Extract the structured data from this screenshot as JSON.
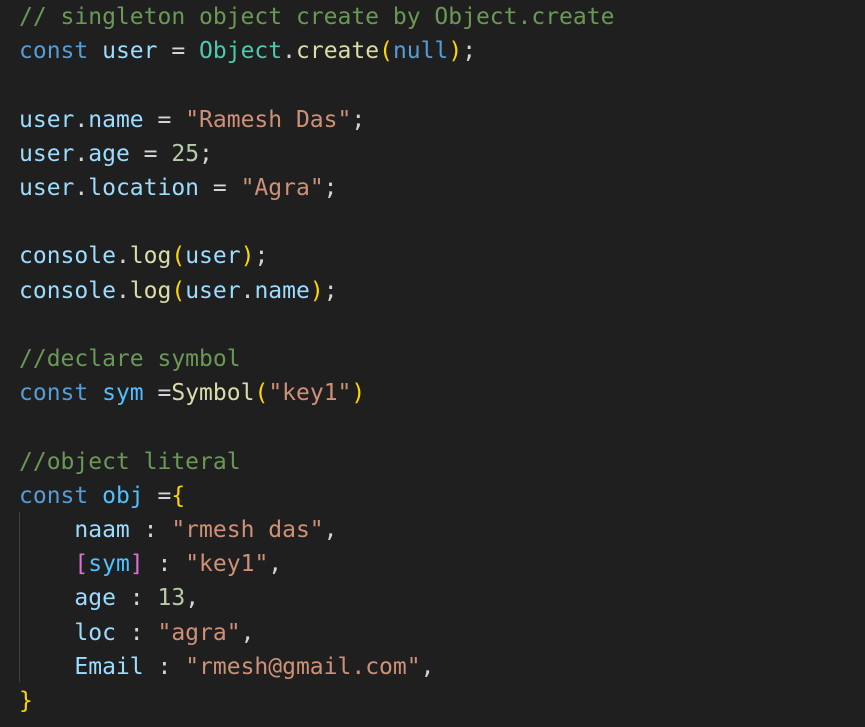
{
  "editor": {
    "lines": [
      {
        "tokens": [
          {
            "t": "// singleton object create by Object.create",
            "c": "cm"
          }
        ]
      },
      {
        "tokens": [
          {
            "t": "const",
            "c": "kw"
          },
          {
            "t": " ",
            "c": "op"
          },
          {
            "t": "user",
            "c": "var"
          },
          {
            "t": " = ",
            "c": "op"
          },
          {
            "t": "Object",
            "c": "cls"
          },
          {
            "t": ".",
            "c": "op"
          },
          {
            "t": "create",
            "c": "fn"
          },
          {
            "t": "(",
            "c": "b1"
          },
          {
            "t": "null",
            "c": "kw"
          },
          {
            "t": ")",
            "c": "b1"
          },
          {
            "t": ";",
            "c": "op"
          }
        ]
      },
      {
        "tokens": []
      },
      {
        "tokens": [
          {
            "t": "user",
            "c": "var"
          },
          {
            "t": ".",
            "c": "op"
          },
          {
            "t": "name",
            "c": "var"
          },
          {
            "t": " = ",
            "c": "op"
          },
          {
            "t": "\"Ramesh Das\"",
            "c": "str"
          },
          {
            "t": ";",
            "c": "op"
          }
        ]
      },
      {
        "tokens": [
          {
            "t": "user",
            "c": "var"
          },
          {
            "t": ".",
            "c": "op"
          },
          {
            "t": "age",
            "c": "var"
          },
          {
            "t": " = ",
            "c": "op"
          },
          {
            "t": "25",
            "c": "num"
          },
          {
            "t": ";",
            "c": "op"
          }
        ]
      },
      {
        "tokens": [
          {
            "t": "user",
            "c": "var"
          },
          {
            "t": ".",
            "c": "op"
          },
          {
            "t": "location",
            "c": "var"
          },
          {
            "t": " = ",
            "c": "op"
          },
          {
            "t": "\"Agra\"",
            "c": "str"
          },
          {
            "t": ";",
            "c": "op"
          }
        ]
      },
      {
        "tokens": []
      },
      {
        "tokens": [
          {
            "t": "console",
            "c": "var"
          },
          {
            "t": ".",
            "c": "op"
          },
          {
            "t": "log",
            "c": "fn"
          },
          {
            "t": "(",
            "c": "b1"
          },
          {
            "t": "user",
            "c": "var"
          },
          {
            "t": ")",
            "c": "b1"
          },
          {
            "t": ";",
            "c": "op"
          }
        ]
      },
      {
        "tokens": [
          {
            "t": "console",
            "c": "var"
          },
          {
            "t": ".",
            "c": "op"
          },
          {
            "t": "log",
            "c": "fn"
          },
          {
            "t": "(",
            "c": "b1"
          },
          {
            "t": "user",
            "c": "var"
          },
          {
            "t": ".",
            "c": "op"
          },
          {
            "t": "name",
            "c": "var"
          },
          {
            "t": ")",
            "c": "b1"
          },
          {
            "t": ";",
            "c": "op"
          }
        ]
      },
      {
        "tokens": []
      },
      {
        "tokens": [
          {
            "t": "//declare symbol",
            "c": "cm"
          }
        ]
      },
      {
        "tokens": [
          {
            "t": "const",
            "c": "kw"
          },
          {
            "t": " ",
            "c": "op"
          },
          {
            "t": "sym",
            "c": "const"
          },
          {
            "t": " =",
            "c": "op"
          },
          {
            "t": "Symbol",
            "c": "fn"
          },
          {
            "t": "(",
            "c": "b1"
          },
          {
            "t": "\"key1\"",
            "c": "str"
          },
          {
            "t": ")",
            "c": "b1"
          }
        ]
      },
      {
        "tokens": []
      },
      {
        "tokens": [
          {
            "t": "//object literal",
            "c": "cm"
          }
        ]
      },
      {
        "tokens": [
          {
            "t": "const",
            "c": "kw"
          },
          {
            "t": " ",
            "c": "op"
          },
          {
            "t": "obj",
            "c": "const"
          },
          {
            "t": " =",
            "c": "op"
          },
          {
            "t": "{",
            "c": "b1"
          }
        ]
      },
      {
        "tokens": [
          {
            "t": "    ",
            "c": "op"
          },
          {
            "t": "naam",
            "c": "var"
          },
          {
            "t": " : ",
            "c": "op"
          },
          {
            "t": "\"rmesh das\"",
            "c": "str"
          },
          {
            "t": ",",
            "c": "op"
          }
        ]
      },
      {
        "tokens": [
          {
            "t": "    ",
            "c": "op"
          },
          {
            "t": "[",
            "c": "b2"
          },
          {
            "t": "sym",
            "c": "const"
          },
          {
            "t": "]",
            "c": "b2"
          },
          {
            "t": " : ",
            "c": "op"
          },
          {
            "t": "\"key1\"",
            "c": "str"
          },
          {
            "t": ",",
            "c": "op"
          }
        ]
      },
      {
        "tokens": [
          {
            "t": "    ",
            "c": "op"
          },
          {
            "t": "age",
            "c": "var"
          },
          {
            "t": " : ",
            "c": "op"
          },
          {
            "t": "13",
            "c": "num"
          },
          {
            "t": ",",
            "c": "op"
          }
        ]
      },
      {
        "tokens": [
          {
            "t": "    ",
            "c": "op"
          },
          {
            "t": "loc",
            "c": "var"
          },
          {
            "t": " : ",
            "c": "op"
          },
          {
            "t": "\"agra\"",
            "c": "str"
          },
          {
            "t": ",",
            "c": "op"
          }
        ]
      },
      {
        "tokens": [
          {
            "t": "    ",
            "c": "op"
          },
          {
            "t": "Email",
            "c": "var"
          },
          {
            "t": " : ",
            "c": "op"
          },
          {
            "t": "\"rmesh@gmail.com\"",
            "c": "str"
          },
          {
            "t": ",",
            "c": "op"
          }
        ]
      },
      {
        "tokens": [
          {
            "t": "}",
            "c": "b1"
          }
        ]
      }
    ]
  },
  "colors": {
    "background": "#1f1f1f",
    "comment": "#6a9955",
    "keyword": "#569cd6",
    "variable": "#9cdcfe",
    "constant": "#4fc1ff",
    "class": "#4ec9b0",
    "function": "#dcdcaa",
    "string": "#ce9178",
    "number": "#b5cea8",
    "bracket_level_1": "#ffd700",
    "bracket_level_2": "#da70d6"
  }
}
